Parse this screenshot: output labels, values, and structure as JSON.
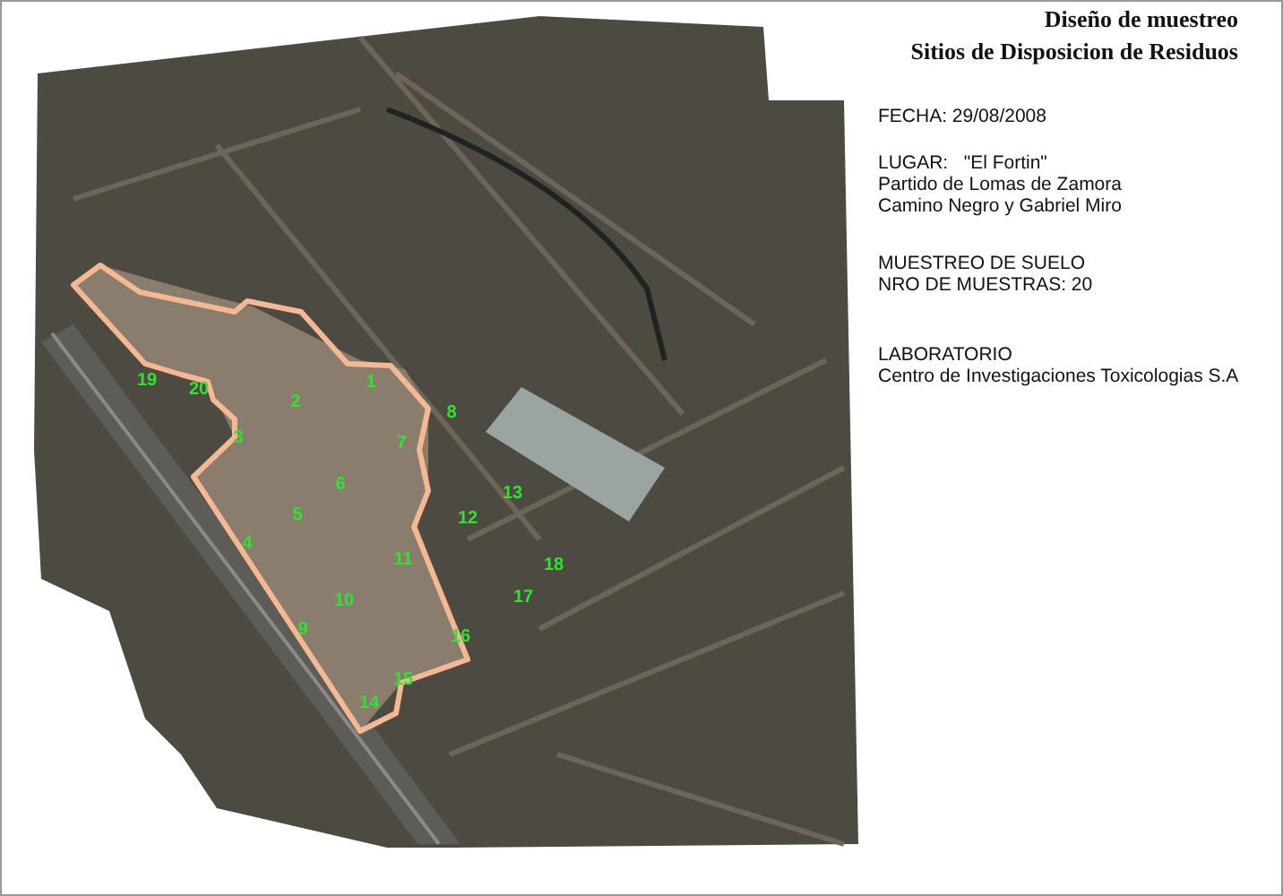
{
  "title": {
    "line1": "Diseño de muestreo",
    "line2": "Sitios de Disposicion de Residuos"
  },
  "info": [
    {
      "lines": [
        "FECHA: 29/08/2008"
      ]
    },
    {
      "lines": [
        "LUGAR:   \"El Fortin\"",
        "Partido de Lomas de Zamora",
        "Camino Negro y Gabriel Miro"
      ]
    },
    {
      "lines": [
        "MUESTREO DE SUELO",
        "NRO DE MUESTRAS: 20"
      ]
    },
    {
      "lines": [
        "LABORATORIO",
        "Centro de Investigaciones Toxicologias S.A"
      ]
    }
  ],
  "map": {
    "samples": [
      {
        "label": "1"
      },
      {
        "label": "2"
      },
      {
        "label": "3"
      },
      {
        "label": "4"
      },
      {
        "label": "5"
      },
      {
        "label": "6"
      },
      {
        "label": "7"
      },
      {
        "label": "8"
      },
      {
        "label": "9"
      },
      {
        "label": "10"
      },
      {
        "label": "11"
      },
      {
        "label": "12"
      },
      {
        "label": "13"
      },
      {
        "label": "14"
      },
      {
        "label": "15"
      },
      {
        "label": "16"
      },
      {
        "label": "17"
      },
      {
        "label": "18"
      },
      {
        "label": "19"
      },
      {
        "label": "20"
      }
    ]
  }
}
